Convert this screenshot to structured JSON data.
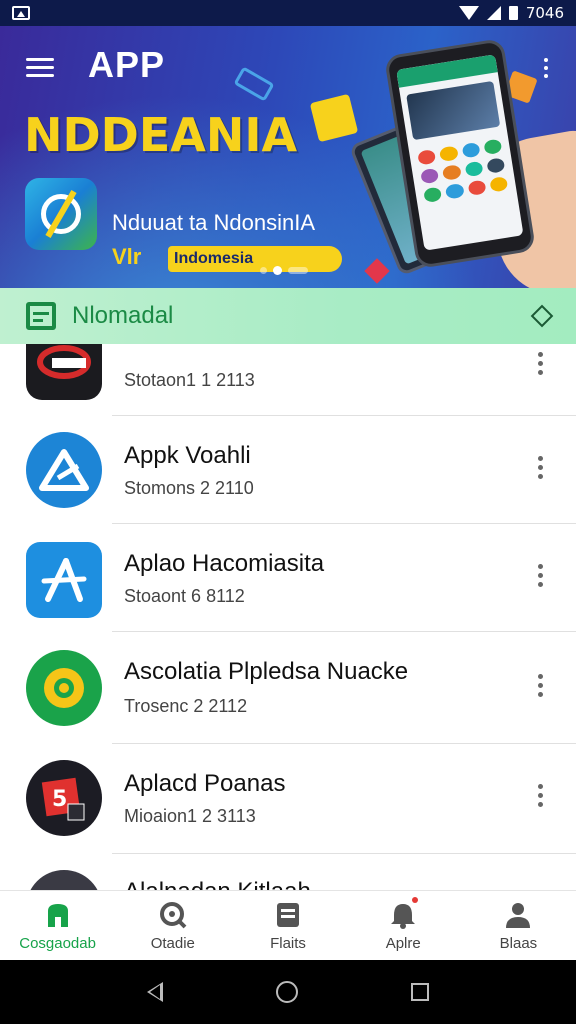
{
  "status_bar": {
    "time": "7046"
  },
  "banner": {
    "app_title": "APP",
    "headline": "NDDEANIA",
    "subtitle": "Nduuat ta NdonsinIA",
    "tag_prefix": "Vlr",
    "tag_label": "Indomesia",
    "carousel_dots": 3,
    "active_dot": 1
  },
  "section": {
    "title": "Nlomadal"
  },
  "apps": [
    {
      "name": "",
      "meta": "Stotaon1 1 2113",
      "icon": "app-icon-red-logo"
    },
    {
      "name": "Appk Voahli",
      "meta": "Stomons 2 2110",
      "icon": "app-icon-blue-triangle"
    },
    {
      "name": "Aplao Hacomiasita",
      "meta": "Stoaont 6 8112",
      "icon": "app-icon-blue-a"
    },
    {
      "name": "Ascolatia Plpledsa Nuacke",
      "meta": "Trosenc 2 2112",
      "icon": "app-icon-green-gear"
    },
    {
      "name": "Aplacd Poanas",
      "meta": "Mioaion1 2 3113",
      "icon": "app-icon-red-square"
    },
    {
      "name": "Alalnadan Kitlaah",
      "meta": "",
      "icon": "app-icon-dark"
    }
  ],
  "bottom_nav": [
    {
      "label": "Cosgaodab",
      "icon": "home-icon",
      "active": true
    },
    {
      "label": "Otadie",
      "icon": "search-icon",
      "active": false
    },
    {
      "label": "Flaits",
      "icon": "stack-icon",
      "active": false
    },
    {
      "label": "Aplre",
      "icon": "bell-icon",
      "active": false,
      "badge": true
    },
    {
      "label": "Blaas",
      "icon": "person-icon",
      "active": false
    }
  ],
  "colors": {
    "accent": "#17a34a",
    "banner_yellow": "#f7d21c",
    "section_green": "#1b8a45"
  }
}
